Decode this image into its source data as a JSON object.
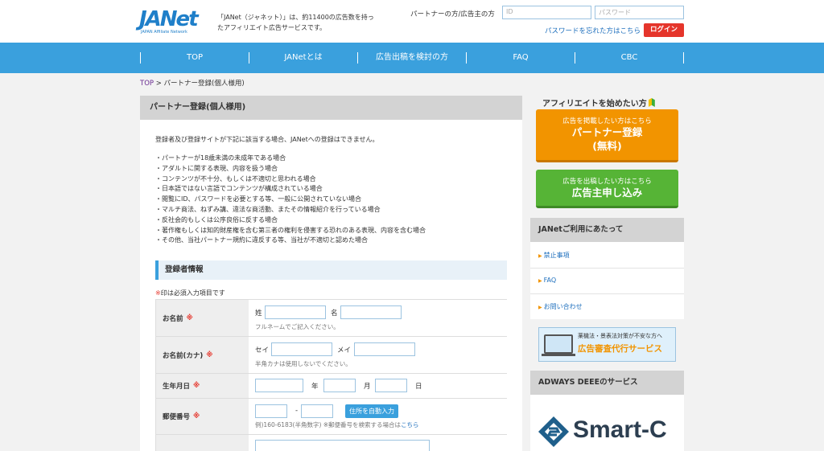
{
  "header": {
    "logo_text": "JANet",
    "logo_sub": "JAPAN Affiliate Network",
    "tagline": "「JANet（ジャネット）」は、約11400の広告数を持ったアフィリエイト広告サービスです。",
    "login_label": "パートナーの方/広告主の方",
    "id_placeholder": "ID",
    "password_placeholder": "パスワード",
    "forgot_password": "パスワードを忘れた方はこちら",
    "login_button": "ログイン"
  },
  "nav": {
    "items": [
      {
        "label": "TOP"
      },
      {
        "label": "JANetとは"
      },
      {
        "label": "広告出稿を検討の方"
      },
      {
        "label": "FAQ"
      },
      {
        "label": "CBC"
      }
    ]
  },
  "breadcrumb": {
    "home": "TOP",
    "separator": ">",
    "current": "パートナー登録(個人様用)"
  },
  "main": {
    "title": "パートナー登録(個人様用)",
    "intro": "登録者及び登録サイトが下記に該当する場合、JANetへの登録はできません。",
    "rules": [
      "・パートナーが18歳未満の未成年である場合",
      "・アダルトに関する表現、内容を扱う場合",
      "・コンテンツが不十分、もしくは不適切と思われる場合",
      "・日本語ではない言語でコンテンツが構成されている場合",
      "・閲覧にID、パスワードを必要とする等、一般に公開されていない場合",
      "・マルチ商法、ねずみ講、違法な商活動、またその情報紹介を行っている場合",
      "・反社会的もしくは公序良俗に反する場合",
      "・著作権もしくは知的財産権を含む第三者の権利を侵害する恐れのある表現、内容を含む場合",
      "・その他、当社パートナー規約に違反する等、当社が不適切と認めた場合"
    ],
    "section_title": "登録者情報",
    "required_mark": "※",
    "required_note": "印は必須入力項目です",
    "form": {
      "name": {
        "label": "お名前",
        "req": "※",
        "sei": "姓",
        "mei": "名",
        "hint": "フルネームでご記入ください。"
      },
      "kana": {
        "label": "お名前(カナ)",
        "req": "※",
        "sei": "セイ",
        "mei": "メイ",
        "hint": "半角カナは使用しないでください。"
      },
      "birth": {
        "label": "生年月日",
        "req": "※",
        "year": "年",
        "month": "月",
        "day": "日"
      },
      "zip": {
        "label": "郵便番号",
        "req": "※",
        "dash": "-",
        "button": "住所を自動入力",
        "hint": "例)160-6183(半角数字) ※郵便番号を検索する場合は",
        "hint_link": "こちら"
      }
    }
  },
  "sidebar": {
    "starter_title": "アフィリエイトを始めたい方",
    "partner_cta": {
      "small": "広告を掲載したい方はこちら",
      "big1": "パートナー登録",
      "big2": "(無料)"
    },
    "advertiser_cta": {
      "small": "広告を出稿したい方はこちら",
      "big": "広告主申し込み"
    },
    "usage_title": "JANetご利用にあたって",
    "usage_links": [
      "禁止事項",
      "FAQ",
      "お問い合わせ"
    ],
    "banner": {
      "line1": "薬機法・景表法対策が不安な方へ",
      "line2": "広告審査代行サービス"
    },
    "adways_title": "ADWAYS DEEEのサービス",
    "smartc_text": "Smart-C"
  },
  "colors": {
    "brand_blue": "#1f7fc9",
    "nav_blue": "#3aa0dd",
    "login_red": "#e5352b",
    "cta_orange": "#f29400",
    "cta_green": "#56b436"
  }
}
